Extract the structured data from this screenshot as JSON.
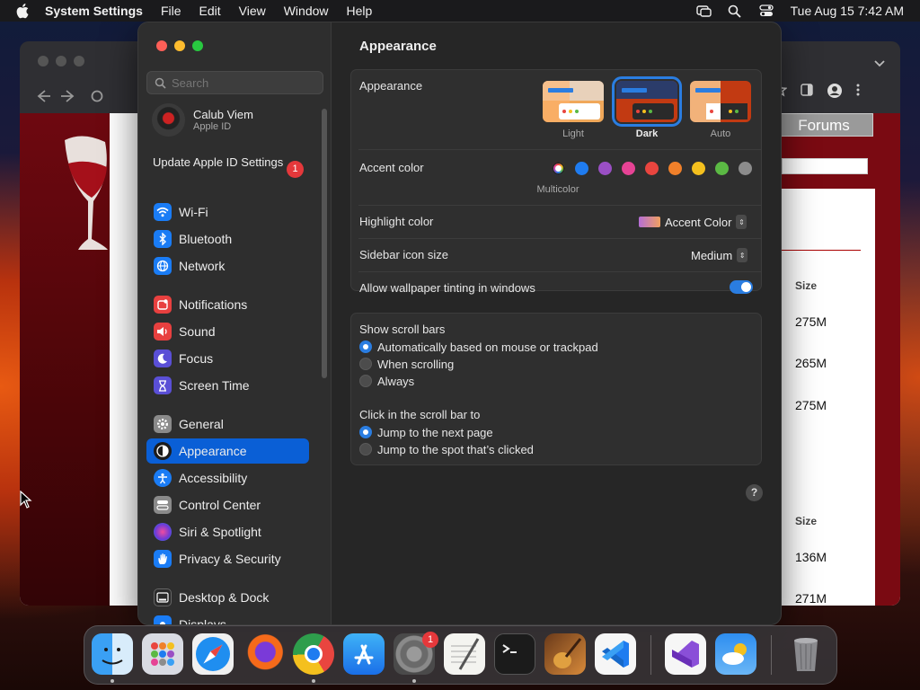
{
  "menubar": {
    "app_name": "System Settings",
    "menus": [
      "File",
      "Edit",
      "View",
      "Window",
      "Help"
    ],
    "datetime": "Tue Aug 15  7:42 AM"
  },
  "background_browser": {
    "tab_button": "Forums",
    "size_header_1": "Size",
    "sizes_1": [
      "275M",
      "265M",
      "275M"
    ],
    "size_header_2": "Size",
    "sizes_2": [
      "136M",
      "271M"
    ]
  },
  "sidebar": {
    "search_placeholder": "Search",
    "user": {
      "name": "Calub Viem",
      "subtitle": "Apple ID"
    },
    "update": {
      "label": "Update Apple ID Settings",
      "badge": "1"
    },
    "items": [
      {
        "label": "Wi-Fi",
        "icon": "wifi-icon",
        "color": "#1a7cf5"
      },
      {
        "label": "Bluetooth",
        "icon": "bluetooth-icon",
        "color": "#1a7cf5"
      },
      {
        "label": "Network",
        "icon": "globe-icon",
        "color": "#1a7cf5"
      },
      {
        "label": "Notifications",
        "icon": "bell-icon",
        "color": "#e8403f"
      },
      {
        "label": "Sound",
        "icon": "speaker-icon",
        "color": "#e8403f"
      },
      {
        "label": "Focus",
        "icon": "moon-icon",
        "color": "#5a4fd6"
      },
      {
        "label": "Screen Time",
        "icon": "hourglass-icon",
        "color": "#5a4fd6"
      },
      {
        "label": "General",
        "icon": "gear-icon",
        "color": "#8a8a8a"
      },
      {
        "label": "Appearance",
        "icon": "appearance-icon",
        "color": "#1c1c1c"
      },
      {
        "label": "Accessibility",
        "icon": "accessibility-icon",
        "color": "#1a7cf5"
      },
      {
        "label": "Control Center",
        "icon": "control-center-icon",
        "color": "#8a8a8a"
      },
      {
        "label": "Siri & Spotlight",
        "icon": "siri-icon",
        "color": "#b03ad0"
      },
      {
        "label": "Privacy & Security",
        "icon": "hand-icon",
        "color": "#1a7cf5"
      },
      {
        "label": "Desktop & Dock",
        "icon": "dock-icon",
        "color": "#2a2a2a"
      },
      {
        "label": "Displays",
        "icon": "display-icon",
        "color": "#1a7cf5"
      }
    ],
    "selected": "Appearance"
  },
  "main": {
    "title": "Appearance",
    "appearance": {
      "label": "Appearance",
      "options": [
        "Light",
        "Dark",
        "Auto"
      ],
      "selected": "Dark"
    },
    "accent": {
      "label": "Accent color",
      "caption": "Multicolor",
      "colors": [
        "multicolor",
        "#1f7cf0",
        "#9a4fc4",
        "#e64395",
        "#e9453f",
        "#f0802a",
        "#f4c01e",
        "#5bb944",
        "#8c8c8c"
      ]
    },
    "highlight": {
      "label": "Highlight color",
      "value": "Accent Color"
    },
    "icon_size": {
      "label": "Sidebar icon size",
      "value": "Medium"
    },
    "tinting": {
      "label": "Allow wallpaper tinting in windows",
      "enabled": true
    },
    "scroll_bars": {
      "label": "Show scroll bars",
      "options": [
        "Automatically based on mouse or trackpad",
        "When scrolling",
        "Always"
      ],
      "selected": 0
    },
    "click_scroll": {
      "label": "Click in the scroll bar to",
      "options": [
        "Jump to the next page",
        "Jump to the spot that’s clicked"
      ],
      "selected": 0
    },
    "help": "?"
  },
  "dock": {
    "apps": [
      {
        "name": "finder-icon"
      },
      {
        "name": "launchpad-icon"
      },
      {
        "name": "safari-icon"
      },
      {
        "name": "firefox-icon"
      },
      {
        "name": "chrome-icon"
      },
      {
        "name": "app-store-icon"
      },
      {
        "name": "system-settings-icon",
        "badge": "1"
      },
      {
        "name": "textedit-icon"
      },
      {
        "name": "terminal-icon"
      },
      {
        "name": "garageband-icon"
      },
      {
        "name": "vscode-icon"
      },
      {
        "name": "visual-studio-icon"
      },
      {
        "name": "weather-icon"
      },
      {
        "name": "trash-icon"
      }
    ],
    "settings_badge": "1"
  }
}
